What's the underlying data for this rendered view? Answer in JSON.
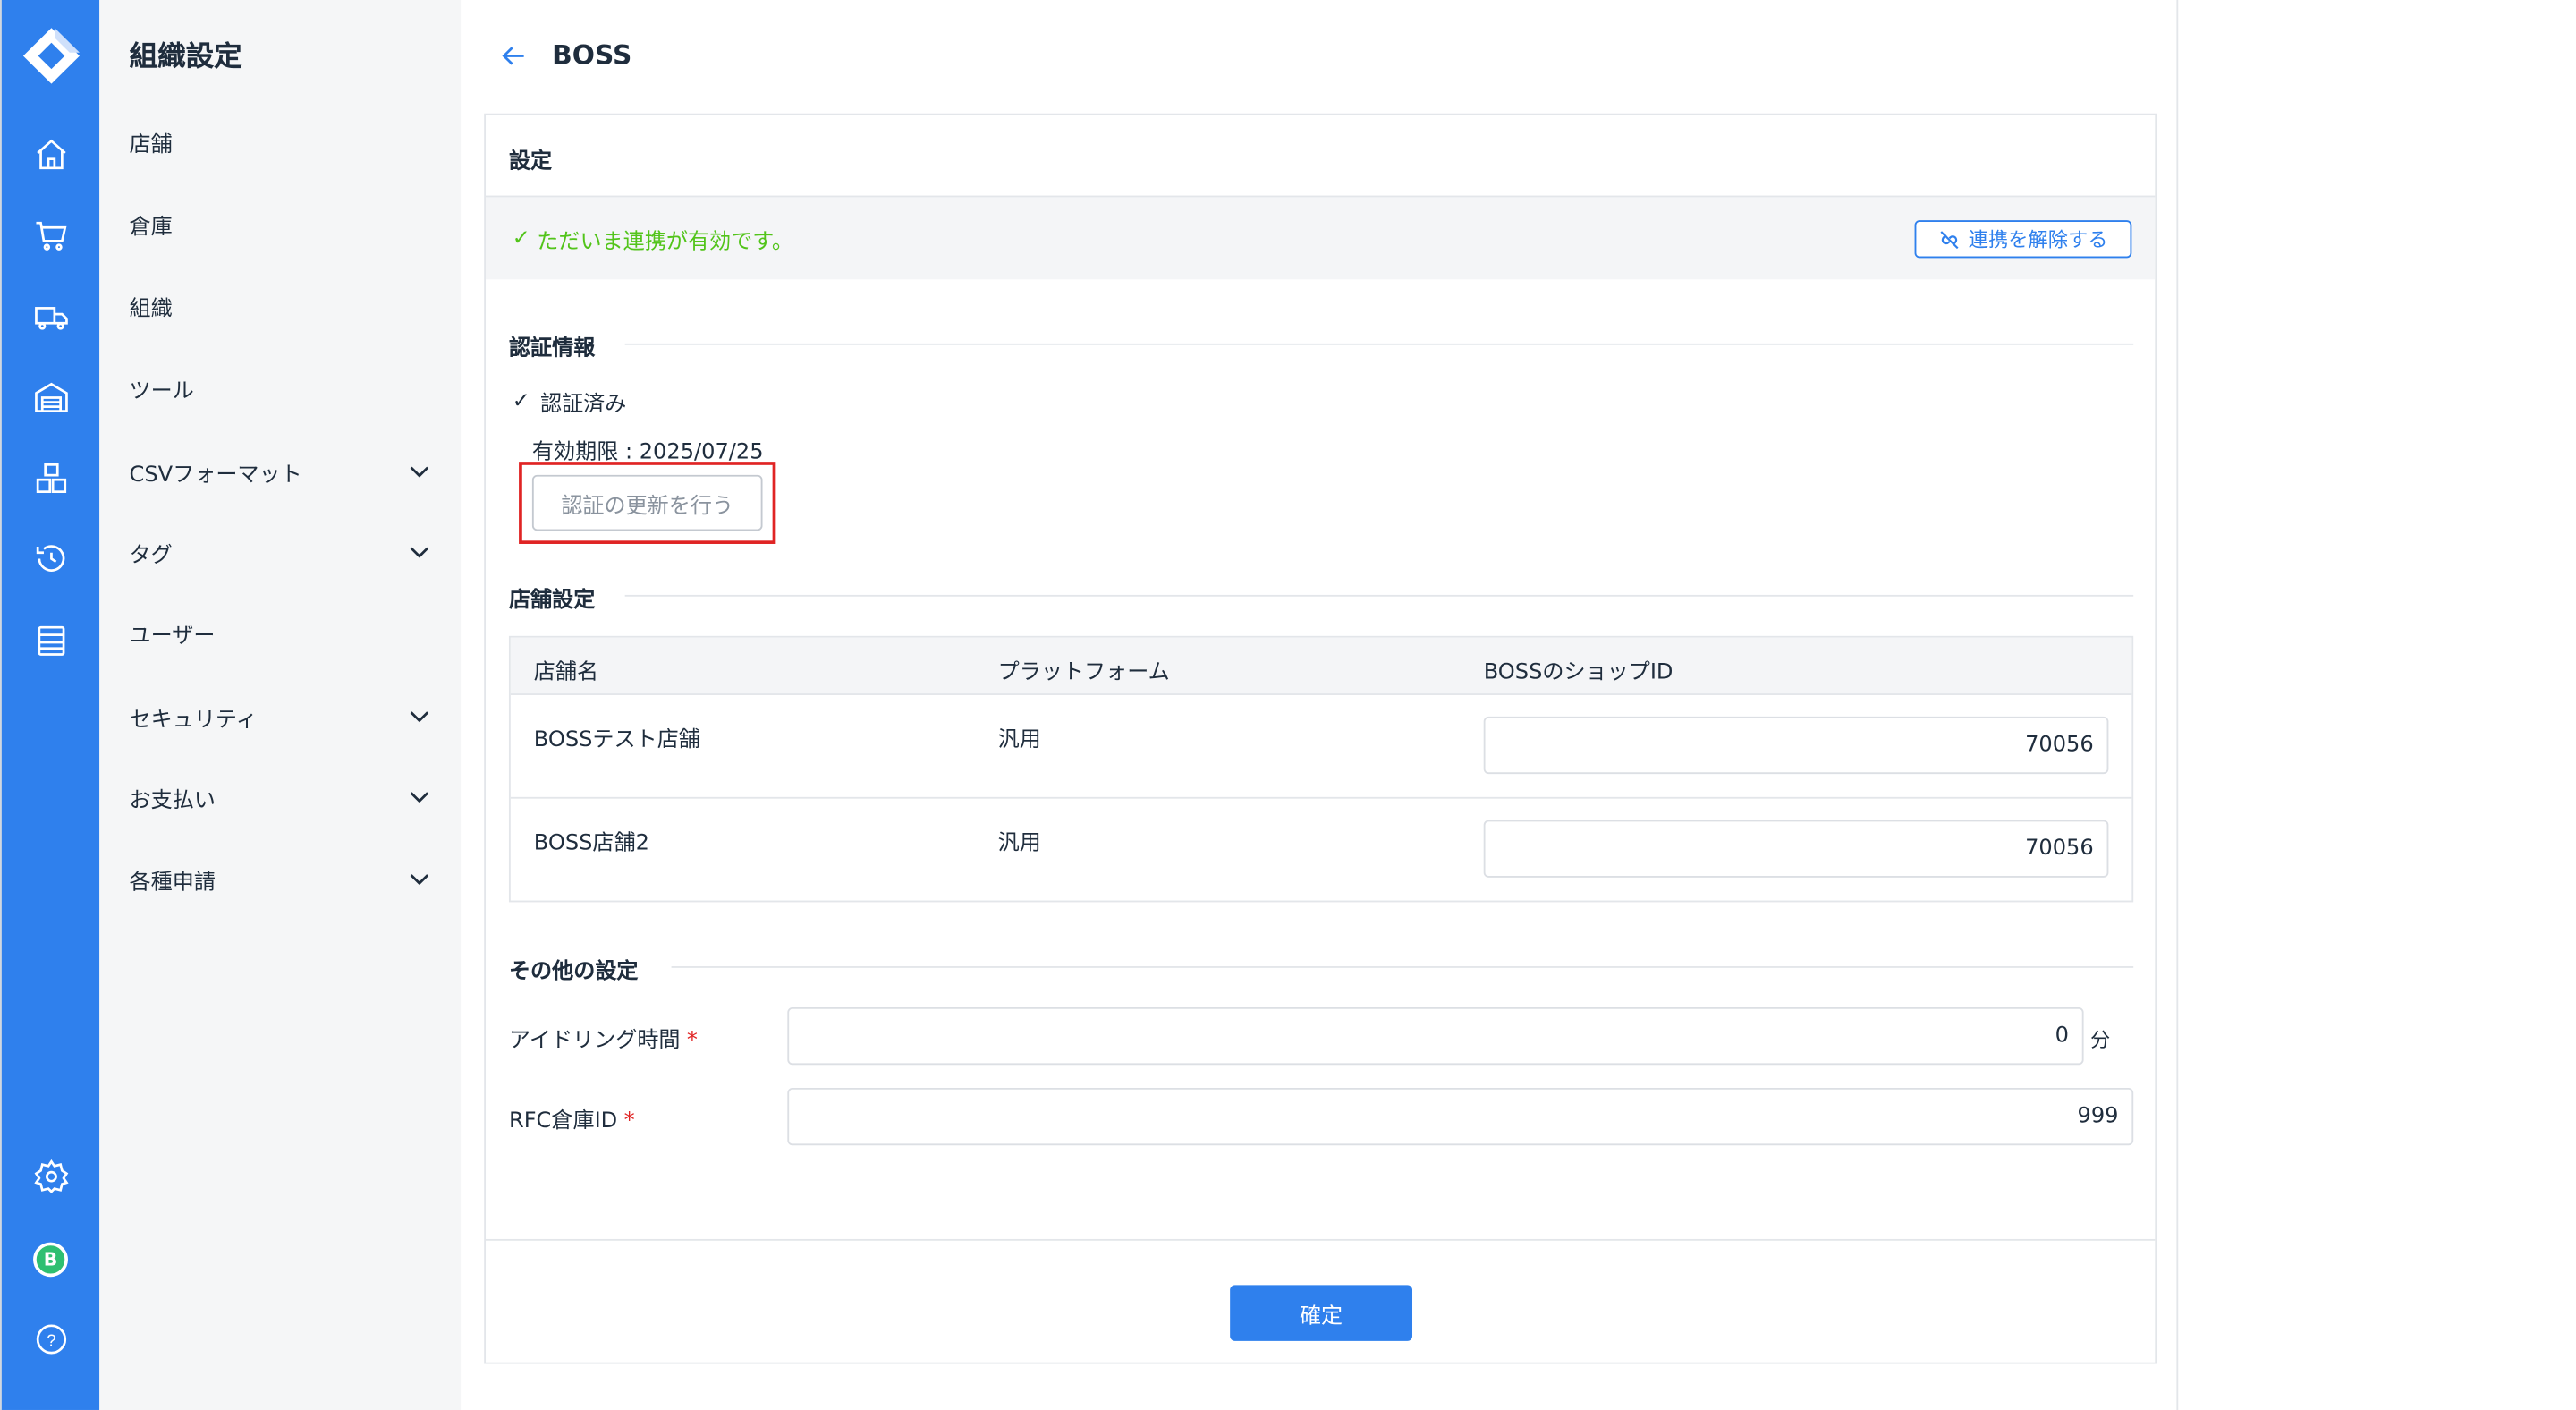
{
  "sidebar": {
    "title": "組織設定",
    "items": [
      {
        "label": "店舗",
        "expandable": false
      },
      {
        "label": "倉庫",
        "expandable": false
      },
      {
        "label": "組織",
        "expandable": false
      },
      {
        "label": "ツール",
        "expandable": false
      },
      {
        "label": "CSVフォーマット",
        "expandable": true
      },
      {
        "label": "タグ",
        "expandable": true
      },
      {
        "label": "ユーザー",
        "expandable": false
      },
      {
        "label": "セキュリティ",
        "expandable": true
      },
      {
        "label": "お支払い",
        "expandable": true
      },
      {
        "label": "各種申請",
        "expandable": true
      }
    ]
  },
  "rail": {
    "icons": [
      "home-icon",
      "cart-icon",
      "truck-icon",
      "warehouse-icon",
      "boxes-icon",
      "history-icon",
      "list-icon",
      "gear-icon",
      "avatar",
      "help-icon"
    ],
    "avatar_letter": "B",
    "help_glyph": "?"
  },
  "header": {
    "title": "BOSS"
  },
  "card": {
    "title": "設定",
    "status": {
      "check": "✓",
      "text": "ただいま連携が有効です。"
    },
    "unlink_button": "連携を解除する"
  },
  "auth": {
    "section_title": "認証情報",
    "check": "✓",
    "status": "認証済み",
    "expiry": "有効期限 : 2025/07/25",
    "renew_button": "認証の更新を行う"
  },
  "stores": {
    "section_title": "店舗設定",
    "columns": [
      "店舗名",
      "プラットフォーム",
      "BOSSのショップID"
    ],
    "rows": [
      {
        "name": "BOSSテスト店舗",
        "platform": "汎用",
        "shop_id": "70056"
      },
      {
        "name": "BOSS店舗2",
        "platform": "汎用",
        "shop_id": "70056"
      }
    ]
  },
  "other": {
    "section_title": "その他の設定",
    "required_mark": "*",
    "idle_label": "アイドリング時間",
    "idle_value": "0",
    "idle_unit": "分",
    "rfc_label": "RFC倉庫ID",
    "rfc_value": "999"
  },
  "confirm_button": "確定",
  "colors": {
    "primary": "#2f80ed",
    "success": "#52c41a",
    "danger": "#e02424",
    "avatar": "#2fbf71"
  }
}
